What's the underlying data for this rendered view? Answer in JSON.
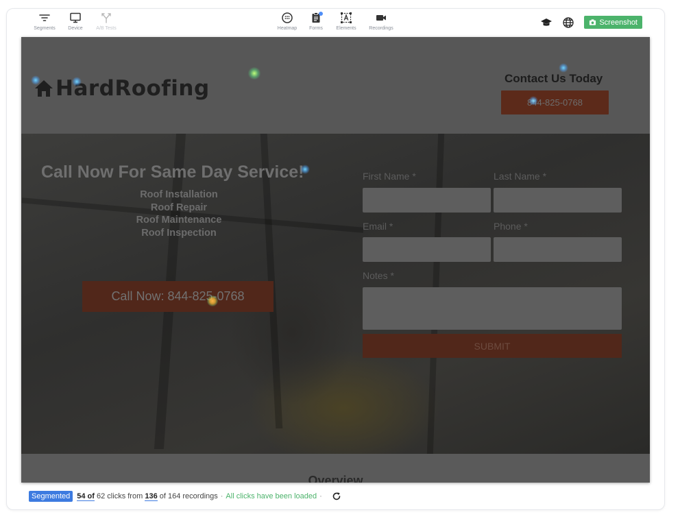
{
  "toolbar": {
    "left": [
      {
        "label": "Segments",
        "icon": "filter-icon"
      },
      {
        "label": "Device",
        "icon": "monitor-icon"
      },
      {
        "label": "A/B Tests",
        "icon": "split-icon"
      }
    ],
    "center": [
      {
        "label": "Heatmap",
        "icon": "heatmap-icon"
      },
      {
        "label": "Forms",
        "icon": "clipboard-icon"
      },
      {
        "label": "Elements",
        "icon": "elements-icon"
      },
      {
        "label": "Recordings",
        "icon": "video-camera-icon"
      }
    ],
    "screenshot_label": "Screenshot"
  },
  "site": {
    "logo": "HardRoofing",
    "contact_title": "Contact Us Today",
    "contact_phone": "844-825-0768",
    "hero_title": "Call Now For Same Day Service!",
    "services": [
      "Roof Installation",
      "Roof Repair",
      "Roof Maintenance",
      "Roof Inspection"
    ],
    "call_button": "Call Now:  844-825-0768",
    "form": {
      "first_name": "First Name *",
      "last_name": "Last Name *",
      "email": "Email *",
      "phone": "Phone *",
      "notes": "Notes *",
      "submit": "SUBMIT"
    },
    "overview": "Overview"
  },
  "status": {
    "segment_badge": "Segmented",
    "clicks_shown": "54 of",
    "clicks_text": "62 clicks from",
    "recordings_shown": "136",
    "recordings_text": "of 164 recordings",
    "loaded_text": "All clicks have been loaded"
  },
  "colors": {
    "accent": "#3d7be0",
    "success": "#4cb36b",
    "cta": "#51271a"
  }
}
